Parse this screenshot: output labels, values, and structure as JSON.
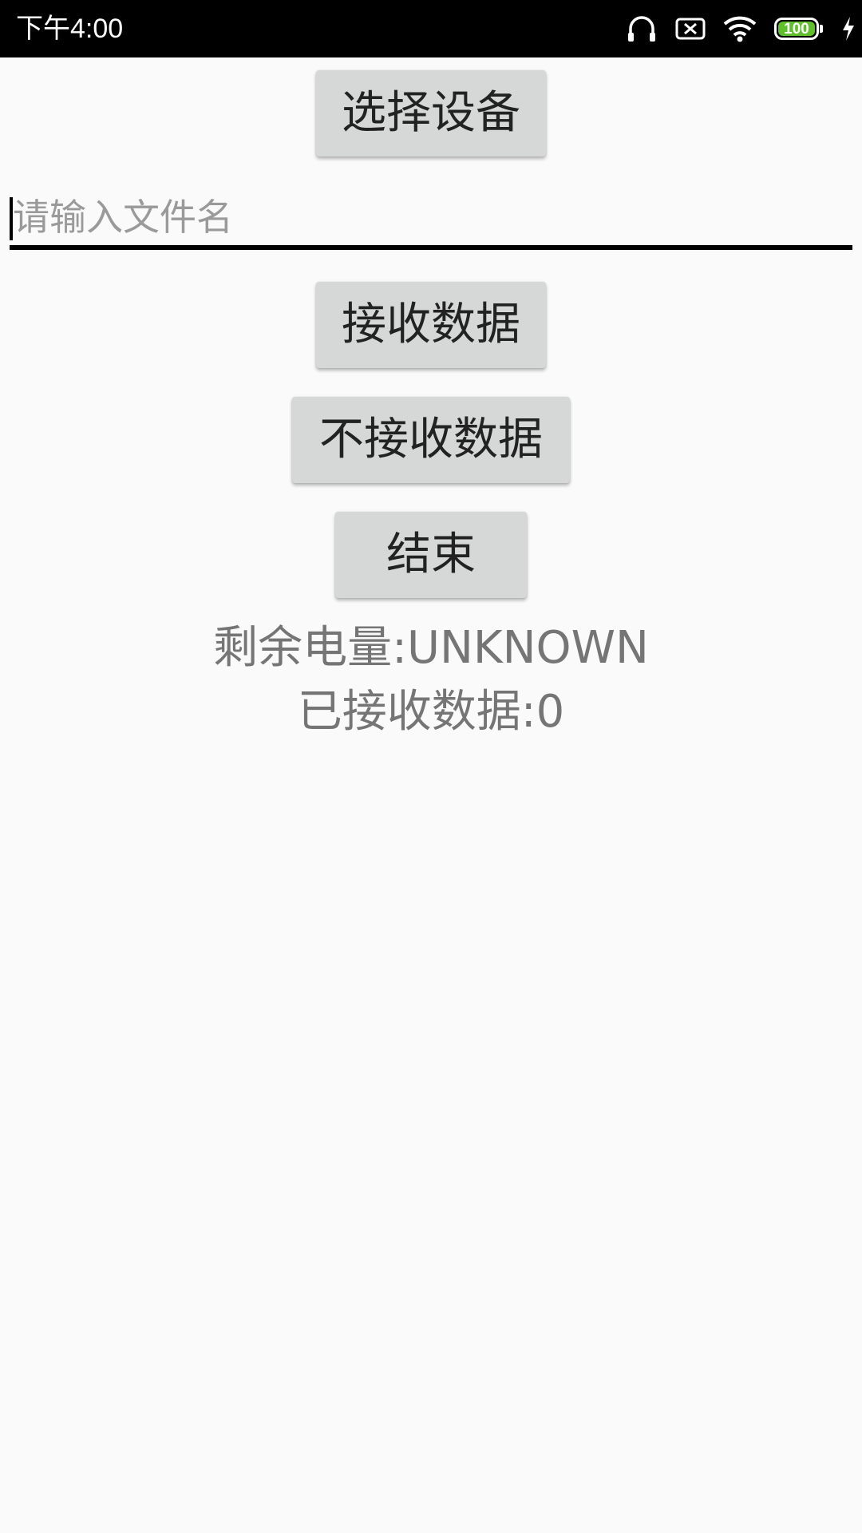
{
  "status_bar": {
    "time": "下午4:00",
    "battery_level": "100",
    "icons": [
      "headphones-icon",
      "sim-off-icon",
      "wifi-icon",
      "battery-icon",
      "charging-icon"
    ],
    "battery_color": "#5fc02b"
  },
  "buttons": {
    "select_device": "选择设备",
    "receive_data": "接收数据",
    "not_receive_data": "不接收数据",
    "end": "结束"
  },
  "filename_input": {
    "value": "",
    "placeholder": "请输入文件名"
  },
  "info": {
    "remaining_battery": "剩余电量:UNKNOWN",
    "received_data": "已接收数据:0"
  },
  "colors": {
    "button_bg": "#d6d7d7",
    "info_text": "#757575",
    "background": "#fafafa"
  }
}
